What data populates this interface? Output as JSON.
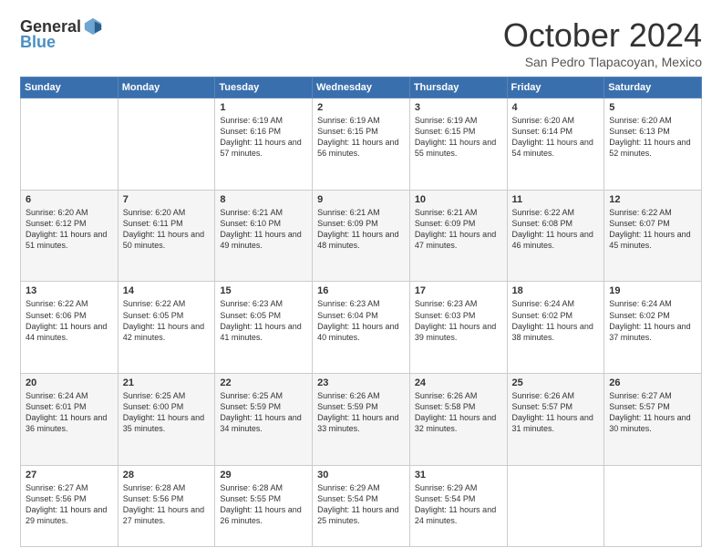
{
  "logo": {
    "general": "General",
    "blue": "Blue"
  },
  "header": {
    "month": "October 2024",
    "location": "San Pedro Tlapacoyan, Mexico"
  },
  "weekdays": [
    "Sunday",
    "Monday",
    "Tuesday",
    "Wednesday",
    "Thursday",
    "Friday",
    "Saturday"
  ],
  "weeks": [
    [
      {
        "day": "",
        "info": ""
      },
      {
        "day": "",
        "info": ""
      },
      {
        "day": "1",
        "info": "Sunrise: 6:19 AM\nSunset: 6:16 PM\nDaylight: 11 hours and 57 minutes."
      },
      {
        "day": "2",
        "info": "Sunrise: 6:19 AM\nSunset: 6:15 PM\nDaylight: 11 hours and 56 minutes."
      },
      {
        "day": "3",
        "info": "Sunrise: 6:19 AM\nSunset: 6:15 PM\nDaylight: 11 hours and 55 minutes."
      },
      {
        "day": "4",
        "info": "Sunrise: 6:20 AM\nSunset: 6:14 PM\nDaylight: 11 hours and 54 minutes."
      },
      {
        "day": "5",
        "info": "Sunrise: 6:20 AM\nSunset: 6:13 PM\nDaylight: 11 hours and 52 minutes."
      }
    ],
    [
      {
        "day": "6",
        "info": "Sunrise: 6:20 AM\nSunset: 6:12 PM\nDaylight: 11 hours and 51 minutes."
      },
      {
        "day": "7",
        "info": "Sunrise: 6:20 AM\nSunset: 6:11 PM\nDaylight: 11 hours and 50 minutes."
      },
      {
        "day": "8",
        "info": "Sunrise: 6:21 AM\nSunset: 6:10 PM\nDaylight: 11 hours and 49 minutes."
      },
      {
        "day": "9",
        "info": "Sunrise: 6:21 AM\nSunset: 6:09 PM\nDaylight: 11 hours and 48 minutes."
      },
      {
        "day": "10",
        "info": "Sunrise: 6:21 AM\nSunset: 6:09 PM\nDaylight: 11 hours and 47 minutes."
      },
      {
        "day": "11",
        "info": "Sunrise: 6:22 AM\nSunset: 6:08 PM\nDaylight: 11 hours and 46 minutes."
      },
      {
        "day": "12",
        "info": "Sunrise: 6:22 AM\nSunset: 6:07 PM\nDaylight: 11 hours and 45 minutes."
      }
    ],
    [
      {
        "day": "13",
        "info": "Sunrise: 6:22 AM\nSunset: 6:06 PM\nDaylight: 11 hours and 44 minutes."
      },
      {
        "day": "14",
        "info": "Sunrise: 6:22 AM\nSunset: 6:05 PM\nDaylight: 11 hours and 42 minutes."
      },
      {
        "day": "15",
        "info": "Sunrise: 6:23 AM\nSunset: 6:05 PM\nDaylight: 11 hours and 41 minutes."
      },
      {
        "day": "16",
        "info": "Sunrise: 6:23 AM\nSunset: 6:04 PM\nDaylight: 11 hours and 40 minutes."
      },
      {
        "day": "17",
        "info": "Sunrise: 6:23 AM\nSunset: 6:03 PM\nDaylight: 11 hours and 39 minutes."
      },
      {
        "day": "18",
        "info": "Sunrise: 6:24 AM\nSunset: 6:02 PM\nDaylight: 11 hours and 38 minutes."
      },
      {
        "day": "19",
        "info": "Sunrise: 6:24 AM\nSunset: 6:02 PM\nDaylight: 11 hours and 37 minutes."
      }
    ],
    [
      {
        "day": "20",
        "info": "Sunrise: 6:24 AM\nSunset: 6:01 PM\nDaylight: 11 hours and 36 minutes."
      },
      {
        "day": "21",
        "info": "Sunrise: 6:25 AM\nSunset: 6:00 PM\nDaylight: 11 hours and 35 minutes."
      },
      {
        "day": "22",
        "info": "Sunrise: 6:25 AM\nSunset: 5:59 PM\nDaylight: 11 hours and 34 minutes."
      },
      {
        "day": "23",
        "info": "Sunrise: 6:26 AM\nSunset: 5:59 PM\nDaylight: 11 hours and 33 minutes."
      },
      {
        "day": "24",
        "info": "Sunrise: 6:26 AM\nSunset: 5:58 PM\nDaylight: 11 hours and 32 minutes."
      },
      {
        "day": "25",
        "info": "Sunrise: 6:26 AM\nSunset: 5:57 PM\nDaylight: 11 hours and 31 minutes."
      },
      {
        "day": "26",
        "info": "Sunrise: 6:27 AM\nSunset: 5:57 PM\nDaylight: 11 hours and 30 minutes."
      }
    ],
    [
      {
        "day": "27",
        "info": "Sunrise: 6:27 AM\nSunset: 5:56 PM\nDaylight: 11 hours and 29 minutes."
      },
      {
        "day": "28",
        "info": "Sunrise: 6:28 AM\nSunset: 5:56 PM\nDaylight: 11 hours and 27 minutes."
      },
      {
        "day": "29",
        "info": "Sunrise: 6:28 AM\nSunset: 5:55 PM\nDaylight: 11 hours and 26 minutes."
      },
      {
        "day": "30",
        "info": "Sunrise: 6:29 AM\nSunset: 5:54 PM\nDaylight: 11 hours and 25 minutes."
      },
      {
        "day": "31",
        "info": "Sunrise: 6:29 AM\nSunset: 5:54 PM\nDaylight: 11 hours and 24 minutes."
      },
      {
        "day": "",
        "info": ""
      },
      {
        "day": "",
        "info": ""
      }
    ]
  ]
}
